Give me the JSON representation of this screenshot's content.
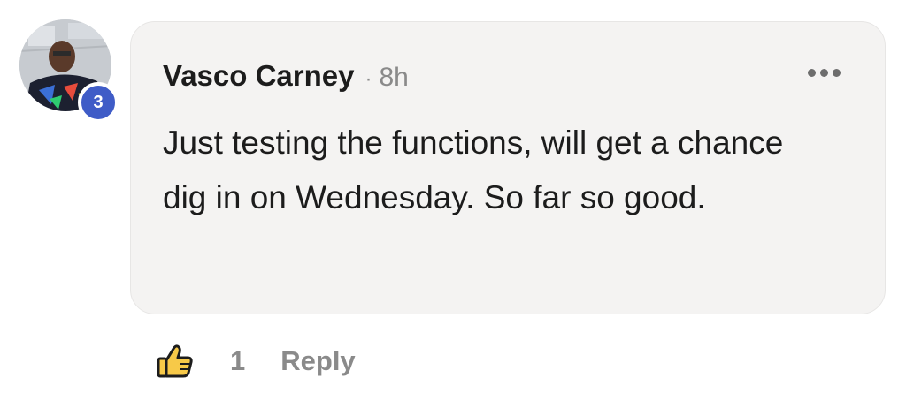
{
  "comment": {
    "author": "Vasco Carney",
    "separator": "·",
    "time": "8h",
    "text": "Just testing the functions, will get a chance dig in on Wednesday. So far so good.",
    "badge_count": "3",
    "badge_color": "#3f5cc7",
    "more_icon": "more-horizontal-icon"
  },
  "actions": {
    "like_icon": "thumbs-up-icon",
    "like_count": "1",
    "reply_label": "Reply"
  }
}
